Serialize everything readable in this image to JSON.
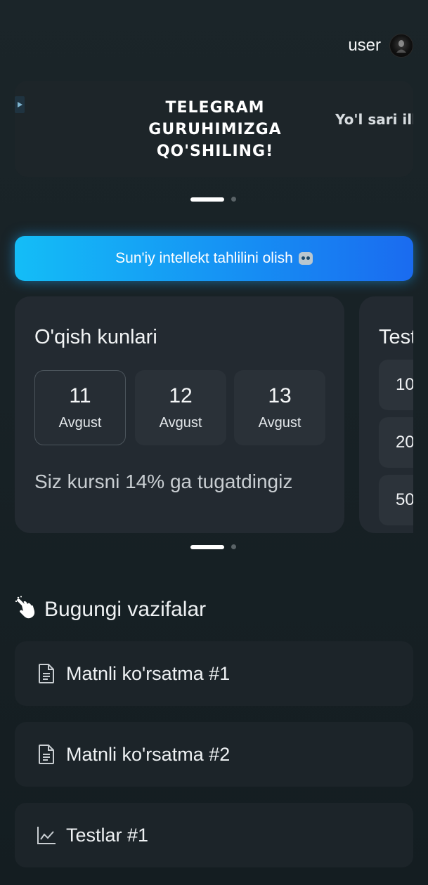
{
  "header": {
    "username": "user",
    "avatar_icon": "avatar-photo"
  },
  "banner": {
    "slides": [
      {
        "title": "Telegram guruhimizga qo'shiling!"
      },
      {
        "title": "Yo'l sari ilk"
      }
    ],
    "active_index": 0,
    "slide_count": 2
  },
  "ai_button": {
    "label": "Sun'iy intellekt tahlilini olish",
    "icon": "robot-icon",
    "colors": [
      "#14bdf7",
      "#1a6bf0"
    ]
  },
  "reading_card": {
    "title": "O'qish kunlari",
    "days": [
      {
        "day": "11",
        "month": "Avgust",
        "selected": true
      },
      {
        "day": "12",
        "month": "Avgust",
        "selected": false
      },
      {
        "day": "13",
        "month": "Avgust",
        "selected": false
      }
    ],
    "progress_text": "Siz kursni 14% ga tugatdingiz",
    "progress_percent": 14
  },
  "tests_card": {
    "title": "Testlar",
    "items": [
      "10",
      "20",
      "50"
    ]
  },
  "cards_carousel": {
    "active_index": 0,
    "slide_count": 2
  },
  "tasks": {
    "title": "Bugungi vazifalar",
    "title_icon": "pointing-hand-icon",
    "items": [
      {
        "label": "Matnli ko'rsatma #1",
        "icon": "document-icon"
      },
      {
        "label": "Matnli ko'rsatma #2",
        "icon": "document-icon"
      },
      {
        "label": "Testlar #1",
        "icon": "chart-line-icon"
      }
    ]
  },
  "colors": {
    "background": "#182226",
    "card": "#232a31",
    "accent": "#168df3"
  }
}
